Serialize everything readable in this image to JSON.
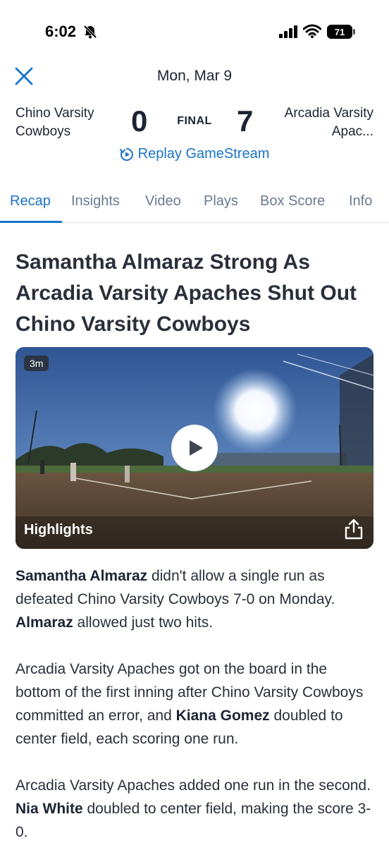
{
  "status": {
    "time": "6:02",
    "battery": "71"
  },
  "header": {
    "date": "Mon, Mar 9",
    "home_team": "Chino Varsity Cowboys",
    "home_score": "0",
    "status": "FINAL",
    "away_score": "7",
    "away_team": "Arcadia Varsity Apac...",
    "replay_label": "Replay GameStream"
  },
  "tabs": [
    "Recap",
    "Insights",
    "Video",
    "Plays",
    "Box Score",
    "Info"
  ],
  "active_tab": "Recap",
  "headline": "Samantha Almaraz Strong As Arcadia Varsity Apaches Shut Out Chino Varsity Cowboys",
  "video": {
    "duration": "3m",
    "title": "Highlights"
  },
  "article": {
    "p1_name": "Samantha Almaraz",
    "p1_text1": " didn't allow a single run as defeated Chino Varsity Cowboys 7-0 on Monday. ",
    "p1_name2": "Almaraz",
    "p1_text2": " allowed just two hits.",
    "p2_text1": "Arcadia Varsity Apaches got on the board in the bottom of the first inning after Chino Varsity Cowboys committed an error, and ",
    "p2_name": "Kiana Gomez",
    "p2_text2": " doubled to center field, each scoring one run.",
    "p3_text1": "Arcadia Varsity Apaches added one run in the second. ",
    "p3_name": "Nia White",
    "p3_text2": " doubled to center field, making the score 3-0."
  },
  "colors": {
    "accent": "#1a73c9",
    "text": "#1c2333",
    "muted": "#6b7a90"
  }
}
